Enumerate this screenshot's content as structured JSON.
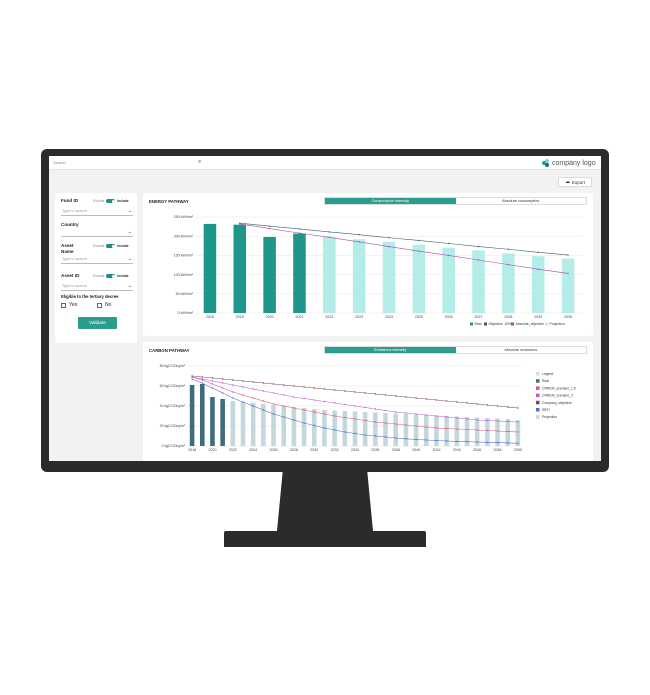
{
  "topbar": {
    "search_placeholder": "Search",
    "logo_text": "company logo"
  },
  "toolbar": {
    "export_label": "Export"
  },
  "filters": {
    "fund_id": {
      "label": "Fund ID",
      "exclude": "Exclude",
      "include": "Include",
      "placeholder": "Type to search"
    },
    "country": {
      "label": "Country"
    },
    "asset_name": {
      "label": "Asset Name",
      "exclude": "Exclude",
      "include": "Include",
      "placeholder": "Type to search"
    },
    "asset_id": {
      "label": "Asset ID",
      "exclude": "Exclude",
      "include": "Include",
      "placeholder": "Type to search"
    },
    "eligible": {
      "label": "Eligible to the tertiary decree",
      "yes": "Yes",
      "no": "No"
    },
    "validate_label": "Validate"
  },
  "energy_panel": {
    "title": "ENERGY PATHWAY",
    "tabs": [
      "Consumption intensity",
      "Absolute consumption"
    ],
    "active_tab": 0
  },
  "carbon_panel": {
    "title": "CARBON PATHWAY",
    "tabs": [
      "Emissions intensity",
      "Absolute emissions"
    ],
    "active_tab": 0
  },
  "chart_data": [
    {
      "type": "bar",
      "title": "ENERGY PATHWAY",
      "categories": [
        "2018",
        "2019",
        "2020",
        "2021",
        "2022",
        "2023",
        "2024",
        "2025",
        "2026",
        "2027",
        "2028",
        "2029",
        "2030"
      ],
      "ylim": [
        0,
        250
      ],
      "ytick_labels": [
        "0 kWh/m²",
        "50 kWh/m²",
        "100 kWh/m²",
        "150 kWh/m²",
        "200 kWh/m²",
        "250 kWh/m²"
      ],
      "ytick_values": [
        0,
        50,
        100,
        150,
        200,
        250
      ],
      "series": [
        {
          "name": "Real",
          "kind": "bar",
          "color": "#1f968a",
          "values": [
            232,
            230,
            198,
            207,
            null,
            null,
            null,
            null,
            null,
            null,
            null,
            null,
            null
          ]
        },
        {
          "name": "Projection",
          "kind": "bar",
          "color": "#b4ece8",
          "values": [
            null,
            null,
            null,
            null,
            198,
            192,
            185,
            178,
            170,
            163,
            155,
            148,
            142
          ]
        },
        {
          "name": "Objective -40%",
          "kind": "line",
          "color": "#3d5a6c",
          "values": [
            null,
            234,
            226,
            219,
            211,
            204,
            196,
            189,
            181,
            173,
            166,
            158,
            151
          ]
        },
        {
          "name": "Absolute_objective",
          "kind": "line",
          "color": "#a64ca6",
          "values": [
            null,
            232,
            220,
            208,
            197,
            185,
            173,
            161,
            150,
            138,
            126,
            114,
            103
          ]
        }
      ],
      "legend": [
        "Real",
        "Objective -40%",
        "Absolute_objective",
        "Projection"
      ],
      "legend_placement": "bottom-right",
      "grid": true
    },
    {
      "type": "bar",
      "title": "CARBON PATHWAY",
      "categories": [
        "2018",
        "2019",
        "2020",
        "2021",
        "2022",
        "2023",
        "2024",
        "2025",
        "2026",
        "2027",
        "2028",
        "2029",
        "2030",
        "2031",
        "2032",
        "2033",
        "2034",
        "2035",
        "2036",
        "2037",
        "2038",
        "2039",
        "2040",
        "2041",
        "2042",
        "2043",
        "2044",
        "2045",
        "2046",
        "2047",
        "2048",
        "2049",
        "2050"
      ],
      "tick_labels": [
        "2018",
        "2020",
        "2022",
        "2024",
        "2026",
        "2028",
        "2030",
        "2032",
        "2034",
        "2036",
        "2038",
        "2040",
        "2042",
        "2044",
        "2046",
        "2048",
        "2050"
      ],
      "ylim": [
        0,
        80
      ],
      "ytick_labels": [
        "0 kgCO2eq/m²",
        "20 kgCO2eq/m²",
        "40 kgCO2eq/m²",
        "60 kgCO2eq/m²",
        "80 kgCO2eq/m²"
      ],
      "ytick_values": [
        0,
        20,
        40,
        60,
        80
      ],
      "series": [
        {
          "name": "Real",
          "kind": "bar",
          "color": "#3f6b7a",
          "values": [
            61,
            62,
            49,
            47,
            null,
            null,
            null,
            null,
            null,
            null,
            null,
            null,
            null,
            null,
            null,
            null,
            null,
            null,
            null,
            null,
            null,
            null,
            null,
            null,
            null,
            null,
            null,
            null,
            null,
            null,
            null,
            null,
            null
          ]
        },
        {
          "name": "Projection",
          "kind": "bar",
          "color": "#c4d7dc",
          "values": [
            null,
            null,
            null,
            null,
            45,
            44,
            43,
            42,
            41,
            40,
            39,
            38,
            37,
            36,
            35.5,
            35,
            34.5,
            34,
            33.5,
            33,
            32.5,
            32,
            31.5,
            31,
            30.5,
            30,
            29.5,
            29,
            28.5,
            28,
            27.5,
            27,
            26
          ]
        },
        {
          "name": "CRREM_scenario_1.5",
          "kind": "line",
          "color": "#e0567a",
          "values": [
            69,
            66,
            62,
            58,
            54,
            51,
            48,
            45,
            42,
            40,
            38,
            36,
            34,
            32,
            30,
            28.5,
            27,
            25.5,
            24,
            23,
            22,
            21,
            20,
            19,
            18,
            17.5,
            17,
            16.5,
            16,
            15.5,
            15,
            14.5,
            14
          ]
        },
        {
          "name": "CRREM_scenario_2",
          "kind": "line",
          "color": "#c05ad0",
          "values": [
            69,
            67,
            65,
            63,
            61,
            59,
            57,
            55,
            53,
            51,
            49,
            47.5,
            46,
            44.5,
            43,
            41.5,
            40,
            38.5,
            37,
            35.5,
            34,
            33,
            32,
            31,
            30,
            29,
            28,
            27,
            26,
            25.5,
            25,
            24.5,
            24
          ]
        },
        {
          "name": "Company_objective",
          "kind": "line",
          "color": "#7a4b55",
          "values": [
            70,
            69,
            68,
            67,
            66,
            65,
            64,
            63,
            62,
            61,
            60,
            59,
            58,
            57,
            56,
            55,
            54,
            53,
            52,
            51,
            50,
            49,
            48,
            47,
            46,
            45,
            44,
            43,
            42,
            41,
            40,
            39,
            38
          ]
        },
        {
          "name": "SBTI",
          "kind": "line",
          "color": "#4a6fd8",
          "values": [
            67,
            63,
            58,
            53,
            48,
            44,
            40,
            36,
            32,
            29,
            26,
            23,
            20.5,
            18,
            16,
            14,
            12.5,
            11,
            10,
            9,
            8,
            7.2,
            6.5,
            6,
            5.5,
            5,
            4.6,
            4.3,
            4,
            3.7,
            3.4,
            3.1,
            2.8
          ]
        }
      ],
      "legend": [
        "Legend",
        "Real",
        "CRREM_scenario_1.5",
        "CRREM_scenario_2",
        "Company_objective",
        "SBTI",
        "Projection"
      ],
      "legend_placement": "right",
      "grid": true
    }
  ]
}
